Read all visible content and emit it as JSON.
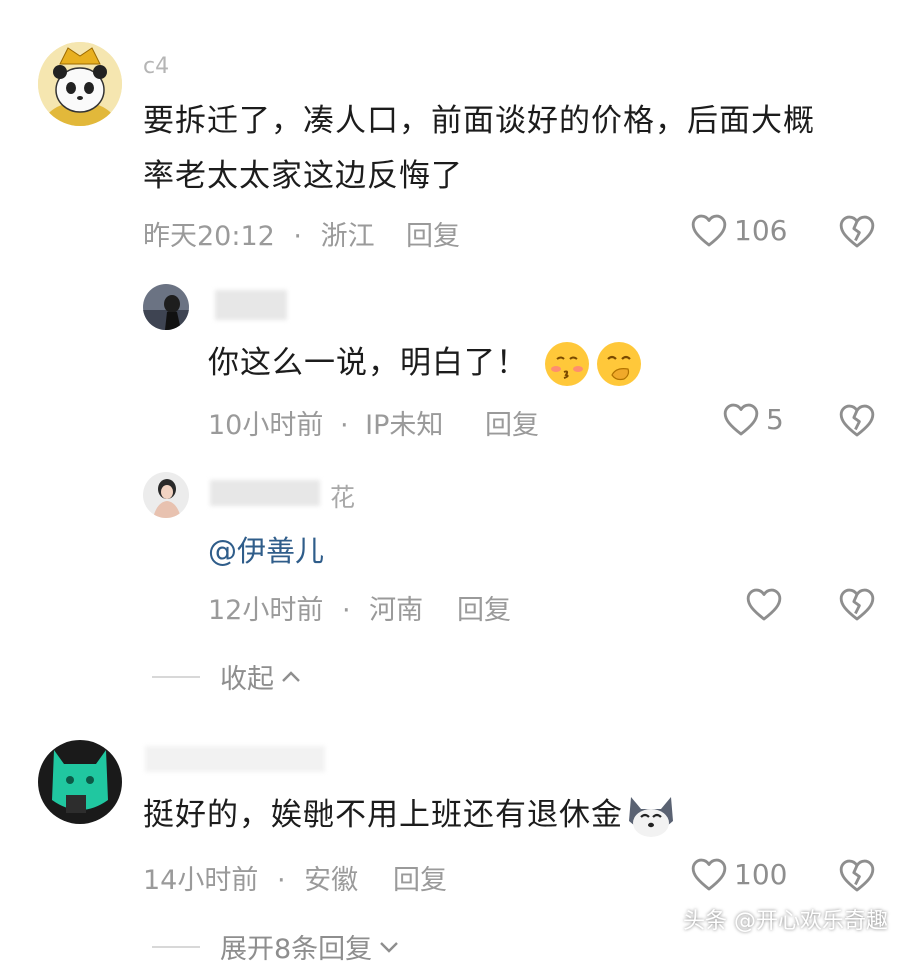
{
  "comments": [
    {
      "username": "c4",
      "text_line1": "要拆迁了，凑人口，前面谈好的价格，后面大概",
      "text_line2": "率老太太家这边反悔了",
      "time": "昨天20:12",
      "location": "浙江",
      "reply_label": "回复",
      "likes": "106",
      "replies": [
        {
          "username": "",
          "text": "你这么一说，明白了！",
          "time": "10小时前",
          "location": "IP未知",
          "reply_label": "回复",
          "likes": "5"
        },
        {
          "username": "花",
          "mention": "@伊善儿",
          "time": "12小时前",
          "location": "河南",
          "reply_label": "回复",
          "likes": ""
        }
      ],
      "collapse_label": "收起"
    },
    {
      "username": "",
      "text": "挺好的，娭毑不用上班还有退休金",
      "time": "14小时前",
      "location": "安徽",
      "reply_label": "回复",
      "likes": "100",
      "expand_label": "展开8条回复"
    }
  ],
  "separator": "·",
  "watermark": "头条 @开心欢乐奇趣",
  "colors": {
    "text": "#1c1c1c",
    "meta": "#9a9a9a",
    "mention": "#2f5d8a",
    "icon": "#8e8e8e"
  }
}
